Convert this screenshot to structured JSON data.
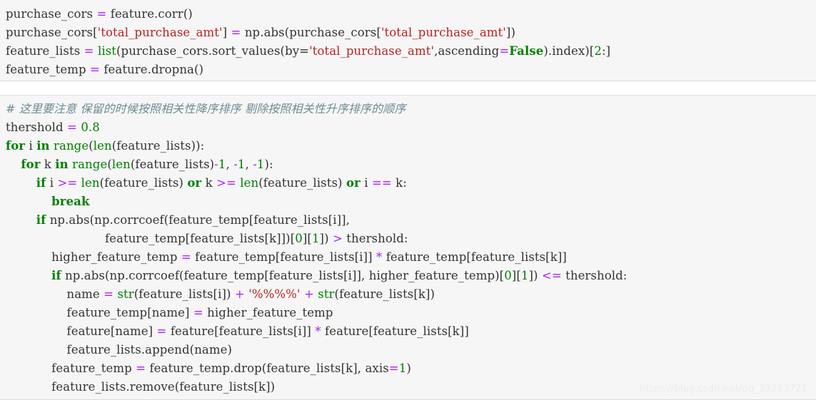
{
  "editor": {
    "language": "python",
    "background_color": "#f6f6f6",
    "text_color": "#333333",
    "theme_colors": {
      "keyword": "#008000",
      "builtin": "#008000",
      "operator": "#aa22ff",
      "number": "#008000",
      "string": "#ba2121",
      "comment": "#6c8b96"
    }
  },
  "block1": {
    "lines": [
      {
        "id": "l1",
        "text": "purchase_cors = feature.corr()",
        "tokens": [
          {
            "t": "purchase_cors ",
            "c": "plain"
          },
          {
            "t": "=",
            "c": "op"
          },
          {
            "t": " feature.corr()",
            "c": "plain"
          }
        ]
      },
      {
        "id": "l2",
        "text": "purchase_cors['total_purchase_amt'] = np.abs(purchase_cors['total_purchase_amt'])",
        "tokens": [
          {
            "t": "purchase_cors[",
            "c": "plain"
          },
          {
            "t": "'total_purchase_amt'",
            "c": "str"
          },
          {
            "t": "] ",
            "c": "plain"
          },
          {
            "t": "=",
            "c": "op"
          },
          {
            "t": " np.abs(purchase_cors[",
            "c": "plain"
          },
          {
            "t": "'total_purchase_amt'",
            "c": "str"
          },
          {
            "t": "])",
            "c": "plain"
          }
        ]
      },
      {
        "id": "l3",
        "text": "feature_lists = list(purchase_cors.sort_values(by='total_purchase_amt',ascending=False).index)[2:]",
        "tokens": [
          {
            "t": "feature_lists ",
            "c": "plain"
          },
          {
            "t": "=",
            "c": "op"
          },
          {
            "t": " ",
            "c": "plain"
          },
          {
            "t": "list",
            "c": "bi"
          },
          {
            "t": "(purchase_cors.sort_values(by=",
            "c": "plain"
          },
          {
            "t": "'total_purchase_amt'",
            "c": "str"
          },
          {
            "t": ",ascending",
            "c": "plain"
          },
          {
            "t": "=",
            "c": "op"
          },
          {
            "t": "False",
            "c": "kw"
          },
          {
            "t": ").index)[",
            "c": "plain"
          },
          {
            "t": "2",
            "c": "num"
          },
          {
            "t": ":]",
            "c": "plain"
          }
        ]
      },
      {
        "id": "l4",
        "text": "feature_temp = feature.dropna()",
        "tokens": [
          {
            "t": "feature_temp ",
            "c": "plain"
          },
          {
            "t": "=",
            "c": "op"
          },
          {
            "t": " feature.dropna()",
            "c": "plain"
          }
        ]
      }
    ]
  },
  "block2": {
    "lines": [
      {
        "id": "c1",
        "text": "# 这里要注意 保留的时候按照相关性降序排序 剔除按照相关性升序排序的顺序",
        "tokens": [
          {
            "t": "# 这里要注意 保留的时候按照相关性降序排序 剔除按照相关性升序排序的顺序",
            "c": "cmt cmt-cn"
          }
        ]
      },
      {
        "id": "c2",
        "text": "thershold = 0.8",
        "tokens": [
          {
            "t": "thershold ",
            "c": "plain"
          },
          {
            "t": "=",
            "c": "op"
          },
          {
            "t": " ",
            "c": "plain"
          },
          {
            "t": "0.8",
            "c": "num"
          }
        ]
      },
      {
        "id": "c3",
        "text": "for i in range(len(feature_lists)):",
        "tokens": [
          {
            "t": "for",
            "c": "kw"
          },
          {
            "t": " i ",
            "c": "plain"
          },
          {
            "t": "in",
            "c": "kw"
          },
          {
            "t": " ",
            "c": "plain"
          },
          {
            "t": "range",
            "c": "bi"
          },
          {
            "t": "(",
            "c": "plain"
          },
          {
            "t": "len",
            "c": "bi"
          },
          {
            "t": "(feature_lists)):",
            "c": "plain"
          }
        ]
      },
      {
        "id": "c4",
        "text": "    for k in range(len(feature_lists)-1, -1, -1):",
        "tokens": [
          {
            "t": "    ",
            "c": "plain"
          },
          {
            "t": "for",
            "c": "kw"
          },
          {
            "t": " k ",
            "c": "plain"
          },
          {
            "t": "in",
            "c": "kw"
          },
          {
            "t": " ",
            "c": "plain"
          },
          {
            "t": "range",
            "c": "bi"
          },
          {
            "t": "(",
            "c": "plain"
          },
          {
            "t": "len",
            "c": "bi"
          },
          {
            "t": "(feature_lists)",
            "c": "plain"
          },
          {
            "t": "-",
            "c": "op"
          },
          {
            "t": "1",
            "c": "num"
          },
          {
            "t": ", ",
            "c": "plain"
          },
          {
            "t": "-",
            "c": "op"
          },
          {
            "t": "1",
            "c": "num"
          },
          {
            "t": ", ",
            "c": "plain"
          },
          {
            "t": "-",
            "c": "op"
          },
          {
            "t": "1",
            "c": "num"
          },
          {
            "t": "):",
            "c": "plain"
          }
        ]
      },
      {
        "id": "c5",
        "text": "        if i >= len(feature_lists) or k >= len(feature_lists) or i == k:",
        "tokens": [
          {
            "t": "        ",
            "c": "plain"
          },
          {
            "t": "if",
            "c": "kw"
          },
          {
            "t": " i ",
            "c": "plain"
          },
          {
            "t": ">=",
            "c": "op"
          },
          {
            "t": " ",
            "c": "plain"
          },
          {
            "t": "len",
            "c": "bi"
          },
          {
            "t": "(feature_lists) ",
            "c": "plain"
          },
          {
            "t": "or",
            "c": "kw"
          },
          {
            "t": " k ",
            "c": "plain"
          },
          {
            "t": ">=",
            "c": "op"
          },
          {
            "t": " ",
            "c": "plain"
          },
          {
            "t": "len",
            "c": "bi"
          },
          {
            "t": "(feature_lists) ",
            "c": "plain"
          },
          {
            "t": "or",
            "c": "kw"
          },
          {
            "t": " i ",
            "c": "plain"
          },
          {
            "t": "==",
            "c": "op"
          },
          {
            "t": " k:",
            "c": "plain"
          }
        ]
      },
      {
        "id": "c6",
        "text": "            break",
        "tokens": [
          {
            "t": "            ",
            "c": "plain"
          },
          {
            "t": "break",
            "c": "kw"
          }
        ]
      },
      {
        "id": "c7",
        "text": "        if np.abs(np.corrcoef(feature_temp[feature_lists[i]],",
        "tokens": [
          {
            "t": "        ",
            "c": "plain"
          },
          {
            "t": "if",
            "c": "kw"
          },
          {
            "t": " np.abs(np.corrcoef(feature_temp[feature_lists[i]],",
            "c": "plain"
          }
        ]
      },
      {
        "id": "c8",
        "text": "                          feature_temp[feature_lists[k]])[0][1]) > thershold:",
        "tokens": [
          {
            "t": "                          feature_temp[feature_lists[k]])[",
            "c": "plain"
          },
          {
            "t": "0",
            "c": "num"
          },
          {
            "t": "][",
            "c": "plain"
          },
          {
            "t": "1",
            "c": "num"
          },
          {
            "t": "]) ",
            "c": "plain"
          },
          {
            "t": ">",
            "c": "op"
          },
          {
            "t": " thershold:",
            "c": "plain"
          }
        ]
      },
      {
        "id": "c9",
        "text": "            higher_feature_temp = feature_temp[feature_lists[i]] * feature_temp[feature_lists[k]]",
        "tokens": [
          {
            "t": "            higher_feature_temp ",
            "c": "plain"
          },
          {
            "t": "=",
            "c": "op"
          },
          {
            "t": " feature_temp[feature_lists[i]] ",
            "c": "plain"
          },
          {
            "t": "*",
            "c": "op"
          },
          {
            "t": " feature_temp[feature_lists[k]]",
            "c": "plain"
          }
        ]
      },
      {
        "id": "c10",
        "text": "            if np.abs(np.corrcoef(feature_temp[feature_lists[i]], higher_feature_temp)[0][1]) <= thershold:",
        "tokens": [
          {
            "t": "            ",
            "c": "plain"
          },
          {
            "t": "if",
            "c": "kw"
          },
          {
            "t": " np.abs(np.corrcoef(feature_temp[feature_lists[i]], higher_feature_temp)[",
            "c": "plain"
          },
          {
            "t": "0",
            "c": "num"
          },
          {
            "t": "][",
            "c": "plain"
          },
          {
            "t": "1",
            "c": "num"
          },
          {
            "t": "]) ",
            "c": "plain"
          },
          {
            "t": "<=",
            "c": "op"
          },
          {
            "t": " thershold:",
            "c": "plain"
          }
        ]
      },
      {
        "id": "c11",
        "text": "                name = str(feature_lists[i]) + '%%%%' + str(feature_lists[k])",
        "tokens": [
          {
            "t": "                name ",
            "c": "plain"
          },
          {
            "t": "=",
            "c": "op"
          },
          {
            "t": " ",
            "c": "plain"
          },
          {
            "t": "str",
            "c": "bi"
          },
          {
            "t": "(feature_lists[i]) ",
            "c": "plain"
          },
          {
            "t": "+",
            "c": "op"
          },
          {
            "t": " ",
            "c": "plain"
          },
          {
            "t": "'%%%%'",
            "c": "str"
          },
          {
            "t": " ",
            "c": "plain"
          },
          {
            "t": "+",
            "c": "op"
          },
          {
            "t": " ",
            "c": "plain"
          },
          {
            "t": "str",
            "c": "bi"
          },
          {
            "t": "(feature_lists[k])",
            "c": "plain"
          }
        ]
      },
      {
        "id": "c12",
        "text": "                feature_temp[name] = higher_feature_temp",
        "tokens": [
          {
            "t": "                feature_temp[name] ",
            "c": "plain"
          },
          {
            "t": "=",
            "c": "op"
          },
          {
            "t": " higher_feature_temp",
            "c": "plain"
          }
        ]
      },
      {
        "id": "c13",
        "text": "                feature[name] = feature[feature_lists[i]] * feature[feature_lists[k]]",
        "tokens": [
          {
            "t": "                feature[name] ",
            "c": "plain"
          },
          {
            "t": "=",
            "c": "op"
          },
          {
            "t": " feature[feature_lists[i]] ",
            "c": "plain"
          },
          {
            "t": "*",
            "c": "op"
          },
          {
            "t": " feature[feature_lists[k]]",
            "c": "plain"
          }
        ]
      },
      {
        "id": "c14",
        "text": "                feature_lists.append(name)",
        "tokens": [
          {
            "t": "                feature_lists.append(name)",
            "c": "plain"
          }
        ]
      },
      {
        "id": "c15",
        "text": "            feature_temp = feature_temp.drop(feature_lists[k], axis=1)",
        "tokens": [
          {
            "t": "            feature_temp ",
            "c": "plain"
          },
          {
            "t": "=",
            "c": "op"
          },
          {
            "t": " feature_temp.drop(feature_lists[k], axis",
            "c": "plain"
          },
          {
            "t": "=",
            "c": "op"
          },
          {
            "t": "1",
            "c": "num"
          },
          {
            "t": ")",
            "c": "plain"
          }
        ]
      },
      {
        "id": "c16",
        "text": "            feature_lists.remove(feature_lists[k])",
        "tokens": [
          {
            "t": "            feature_lists.remove(feature_lists[k])",
            "c": "plain"
          }
        ]
      }
    ]
  },
  "watermark": {
    "text": "https://blog.csdn.net/qq_33253721"
  }
}
